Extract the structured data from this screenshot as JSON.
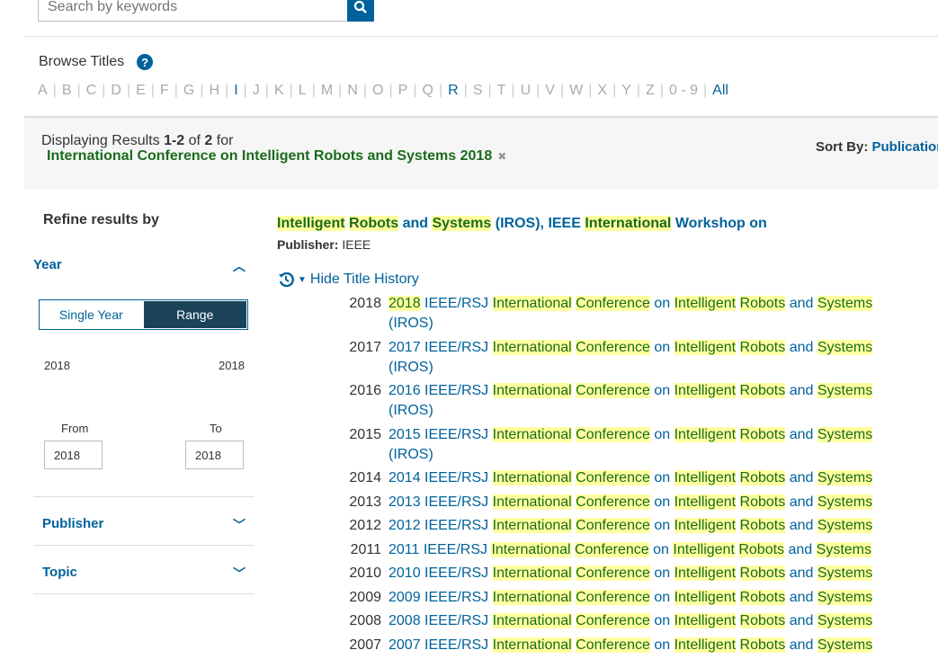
{
  "search": {
    "placeholder": "Search by keywords",
    "icon": "search-icon"
  },
  "browse": {
    "label": "Browse Titles",
    "help": "?",
    "letters": [
      "A",
      "B",
      "C",
      "D",
      "E",
      "F",
      "G",
      "H",
      "I",
      "J",
      "K",
      "L",
      "M",
      "N",
      "O",
      "P",
      "Q",
      "R",
      "S",
      "T",
      "U",
      "V",
      "W",
      "X",
      "Y",
      "Z",
      "0 - 9",
      "All"
    ],
    "active": [
      "I",
      "R",
      "All"
    ]
  },
  "results": {
    "prefix": "Displaying Results ",
    "range": "1-2",
    "of": " of ",
    "total": "2",
    "for": " for",
    "query": "International Conference on Intelligent Robots and Systems 2018",
    "clear": "✖"
  },
  "sort": {
    "label": "Sort By:",
    "value": "Publication"
  },
  "sidebar": {
    "title": "Refine results by",
    "year": "Year",
    "single": "Single Year",
    "range": "Range",
    "min": "2018",
    "max": "2018",
    "from_label": "From",
    "to_label": "To",
    "from": "2018",
    "to": "2018",
    "publisher": "Publisher",
    "topic": "Topic"
  },
  "highlights": [
    "2018",
    "International",
    "Conference",
    "Intelligent",
    "Robots",
    "Systems"
  ],
  "result": {
    "title": "Intelligent Robots and Systems (IROS), IEEE International Workshop on",
    "publisher_label": "Publisher:",
    "publisher": "IEEE",
    "history_label": "Hide Title History",
    "history": [
      {
        "year": "2018",
        "title": "2018 IEEE/RSJ International Conference on Intelligent Robots and Systems (IROS)"
      },
      {
        "year": "2017",
        "title": "2017 IEEE/RSJ International Conference on Intelligent Robots and Systems (IROS)"
      },
      {
        "year": "2016",
        "title": "2016 IEEE/RSJ International Conference on Intelligent Robots and Systems (IROS)"
      },
      {
        "year": "2015",
        "title": "2015 IEEE/RSJ International Conference on Intelligent Robots and Systems (IROS)"
      },
      {
        "year": "2014",
        "title": "2014 IEEE/RSJ International Conference on Intelligent Robots and Systems"
      },
      {
        "year": "2013",
        "title": "2013 IEEE/RSJ International Conference on Intelligent Robots and Systems"
      },
      {
        "year": "2012",
        "title": "2012 IEEE/RSJ International Conference on Intelligent Robots and Systems"
      },
      {
        "year": "2011",
        "title": "2011 IEEE/RSJ International Conference on Intelligent Robots and Systems"
      },
      {
        "year": "2010",
        "title": "2010 IEEE/RSJ International Conference on Intelligent Robots and Systems"
      },
      {
        "year": "2009",
        "title": "2009 IEEE/RSJ International Conference on Intelligent Robots and Systems"
      },
      {
        "year": "2008",
        "title": "2008 IEEE/RSJ International Conference on Intelligent Robots and Systems"
      },
      {
        "year": "2007",
        "title": "2007 IEEE/RSJ International Conference on Intelligent Robots and Systems"
      }
    ]
  }
}
